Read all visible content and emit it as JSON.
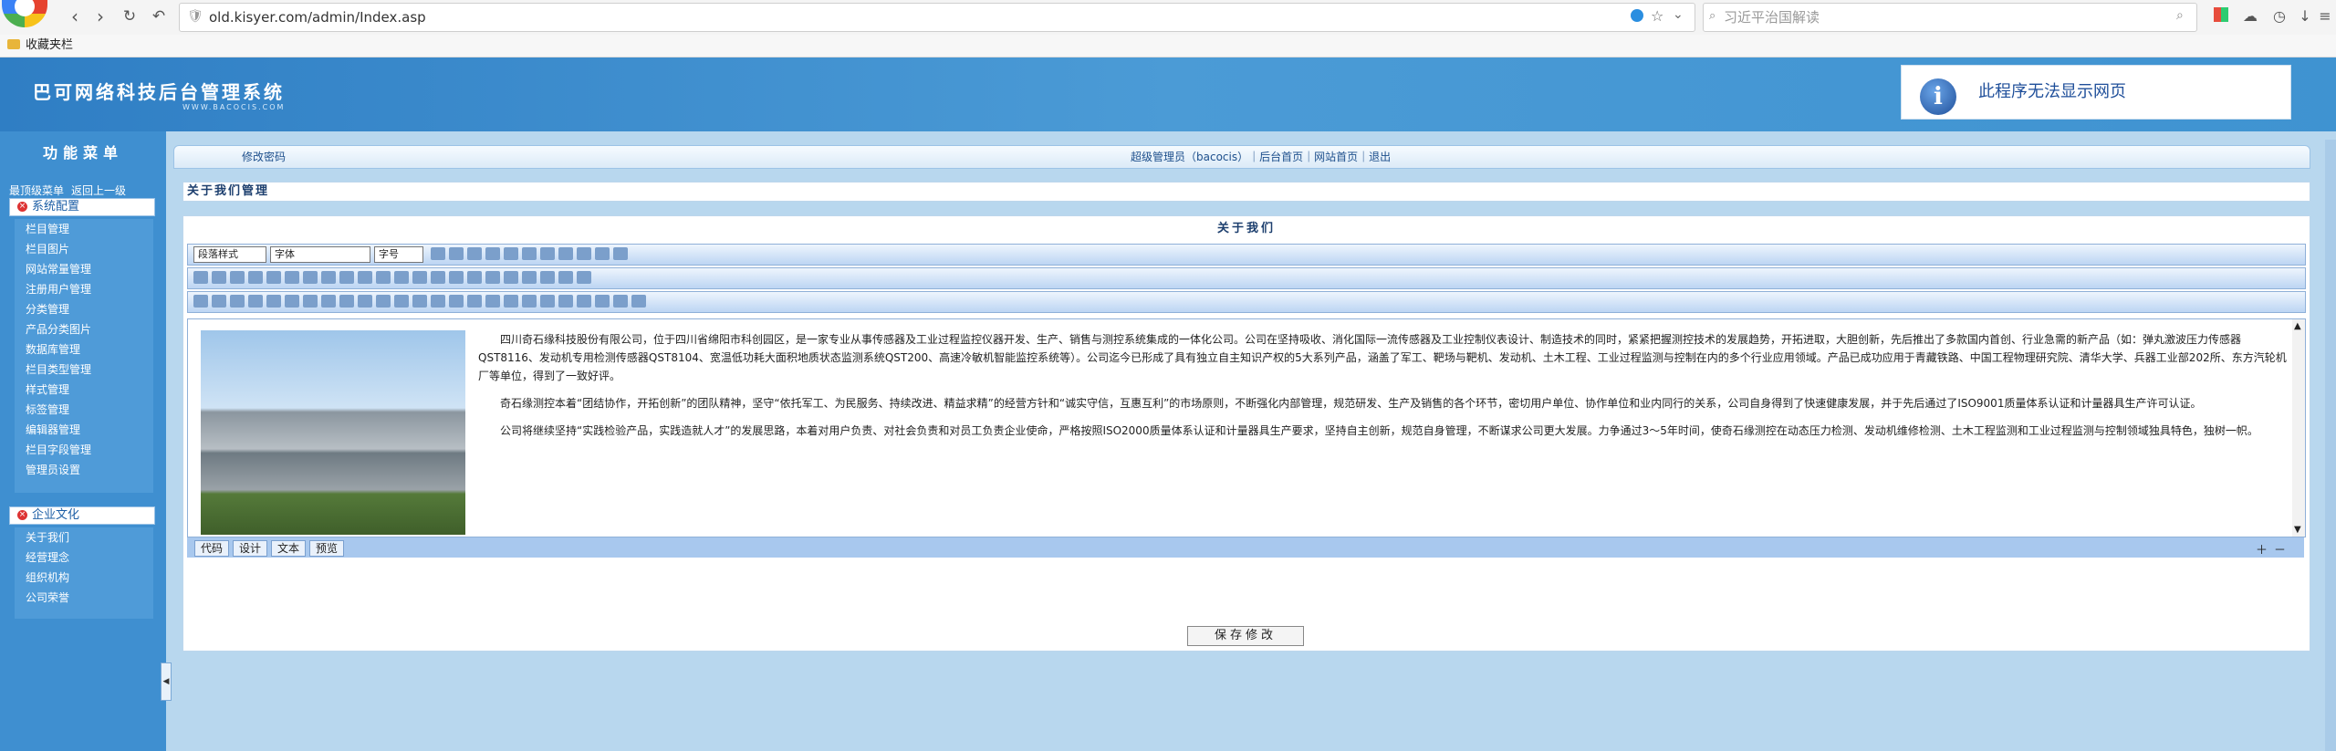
{
  "browser": {
    "url": "old.kisyer.com/admin/Index.asp",
    "search_placeholder": "习近平治国解读",
    "bookmarks_label": "收藏夹栏"
  },
  "header": {
    "title": "巴可网络科技后台管理系统",
    "subtitle": "WWW.BACOCIS.COM",
    "error_text": "此程序无法显示网页"
  },
  "sidebar": {
    "title": "功能菜单",
    "links": [
      "最顶级菜单",
      "返回上一级"
    ],
    "groups": [
      {
        "label": "系统配置",
        "items": [
          "栏目管理",
          "栏目图片",
          "网站常量管理",
          "注册用户管理",
          "分类管理",
          "产品分类图片",
          "数据库管理",
          "栏目类型管理",
          "样式管理",
          "标签管理",
          "编辑器管理",
          "栏目字段管理",
          "管理员设置"
        ]
      },
      {
        "label": "企业文化",
        "items": [
          "关于我们",
          "经营理念",
          "组织机构",
          "公司荣誉"
        ]
      }
    ]
  },
  "topbar": {
    "change_password": "修改密码",
    "user_links": "超级管理员（bacocis）｜后台首页｜网站首页｜退出"
  },
  "section": {
    "title": "关于我们管理"
  },
  "editor": {
    "title": "关于我们",
    "paragraph_style": "段落样式",
    "font": "字体",
    "size": "字号",
    "paragraphs": [
      "四川奇石缘科技股份有限公司，位于四川省绵阳市科创园区，是一家专业从事传感器及工业过程监控仪器开发、生产、销售与测控系统集成的一体化公司。公司在坚持吸收、消化国际一流传感器及工业控制仪表设计、制造技术的同时，紧紧把握测控技术的发展趋势，开拓进取，大胆创新，先后推出了多款国内首创、行业急需的新产品（如：弹丸激波压力传感器QST8116、发动机专用检测传感器QST8104、宽温低功耗大面积地质状态监测系统QST200、高速冷敏机智能监控系统等）。公司迄今已形成了具有独立自主知识产权的5大系列产品，涵盖了军工、靶场与靶机、发动机、土木工程、工业过程监测与控制在内的多个行业应用领域。产品已成功应用于青藏铁路、中国工程物理研究院、清华大学、兵器工业部202所、东方汽轮机厂等单位，得到了一致好评。",
      "奇石缘测控本着“团结协作，开拓创新”的团队精神，坚守“依托军工、为民服务、持续改进、精益求精”的经营方针和“诚实守信，互惠互利”的市场原则，不断强化内部管理，规范研发、生产及销售的各个环节，密切用户单位、协作单位和业内同行的关系，公司自身得到了快速健康发展，并于先后通过了ISO9001质量体系认证和计量器具生产许可认证。",
      "公司将继续坚持“实践检验产品，实践造就人才”的发展思路，本着对用户负责、对社会负责和对员工负责企业使命，严格按照ISO2000质量体系认证和计量器具生产要求，坚持自主创新，规范自身管理，不断谋求公司更大发展。力争通过3～5年时间，使奇石缘测控在动态压力检测、发动机维修检测、土木工程监测和工业过程监测与控制领域独具特色，独树一帜。"
    ],
    "modes": [
      "代码",
      "设计",
      "文本",
      "预览"
    ],
    "save_label": "保存修改"
  }
}
